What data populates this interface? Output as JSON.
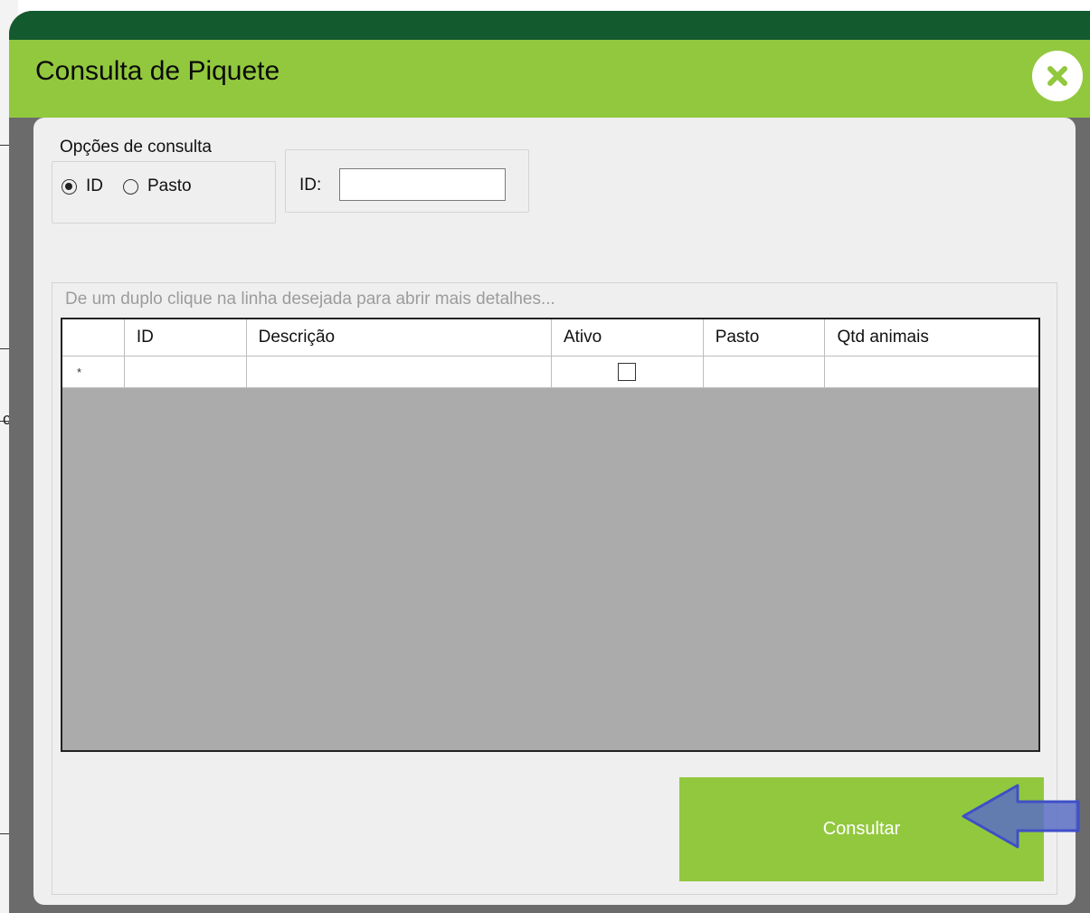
{
  "window": {
    "title": "Consulta de Piquete",
    "close_icon": "close-icon",
    "colors": {
      "title_bar": "#92c83e",
      "title_top": "#135a2e",
      "button": "#92c83e"
    }
  },
  "background": {
    "fragment_char": "c"
  },
  "search_options": {
    "group_label": "Opções de consulta",
    "options": [
      {
        "label": "ID",
        "selected": true
      },
      {
        "label": "Pasto",
        "selected": false
      }
    ],
    "id_label": "ID:",
    "id_value": ""
  },
  "results": {
    "hint": "De um duplo clique na linha desejada para abrir mais detalhes...",
    "columns": [
      "ID",
      "Descrição",
      "Ativo",
      "Pasto",
      "Qtd animais"
    ],
    "new_row_marker": "*",
    "rows": [
      {
        "id": "",
        "descricao": "",
        "ativo": false,
        "pasto": "",
        "qtd_animais": ""
      }
    ]
  },
  "actions": {
    "consultar_label": "Consultar",
    "pointer_icon": "left-arrow-icon"
  }
}
